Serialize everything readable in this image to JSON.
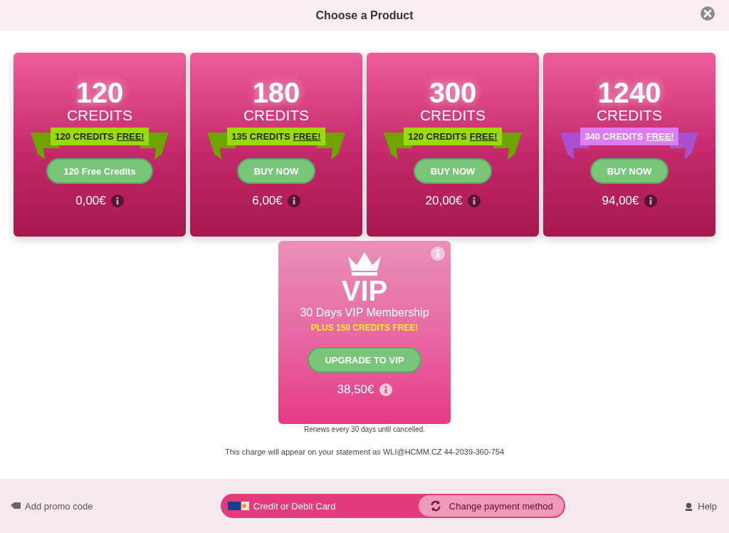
{
  "header": {
    "title": "Choose a Product"
  },
  "products": [
    {
      "amount": "120",
      "unit": "CREDITS",
      "ribbon": {
        "kind": "green",
        "text": "120 CREDITS",
        "link": "FREE!"
      },
      "button": "120 Free Credits",
      "price": "0,00€"
    },
    {
      "amount": "180",
      "unit": "CREDITS",
      "ribbon": {
        "kind": "green",
        "text": "135 CREDITS",
        "link": "FREE!"
      },
      "button": "BUY NOW",
      "price": "6,00€"
    },
    {
      "amount": "300",
      "unit": "CREDITS",
      "ribbon": {
        "kind": "green",
        "text": "120 CREDITS",
        "link": "FREE!"
      },
      "button": "BUY NOW",
      "price": "20,00€"
    },
    {
      "amount": "1240",
      "unit": "CREDITS",
      "ribbon": {
        "kind": "purple",
        "text": "340 CREDITS",
        "link": "FREE!"
      },
      "button": "BUY NOW",
      "price": "94,00€"
    }
  ],
  "vip": {
    "title": "VIP",
    "subtitle": "30 Days VIP Membership",
    "bonus": "PLUS 150 CREDITS FREE!",
    "button": "UPGRADE TO VIP",
    "price": "38,50€",
    "note": "Renews every 30 days until cancelled."
  },
  "statement": "This charge will appear on your statement as WLI@HCMM.CZ 44-2039-360-754",
  "footer": {
    "promo": "Add promo code",
    "payment": "Credit or Debit Card",
    "change": "Change payment method",
    "help": "Help"
  }
}
